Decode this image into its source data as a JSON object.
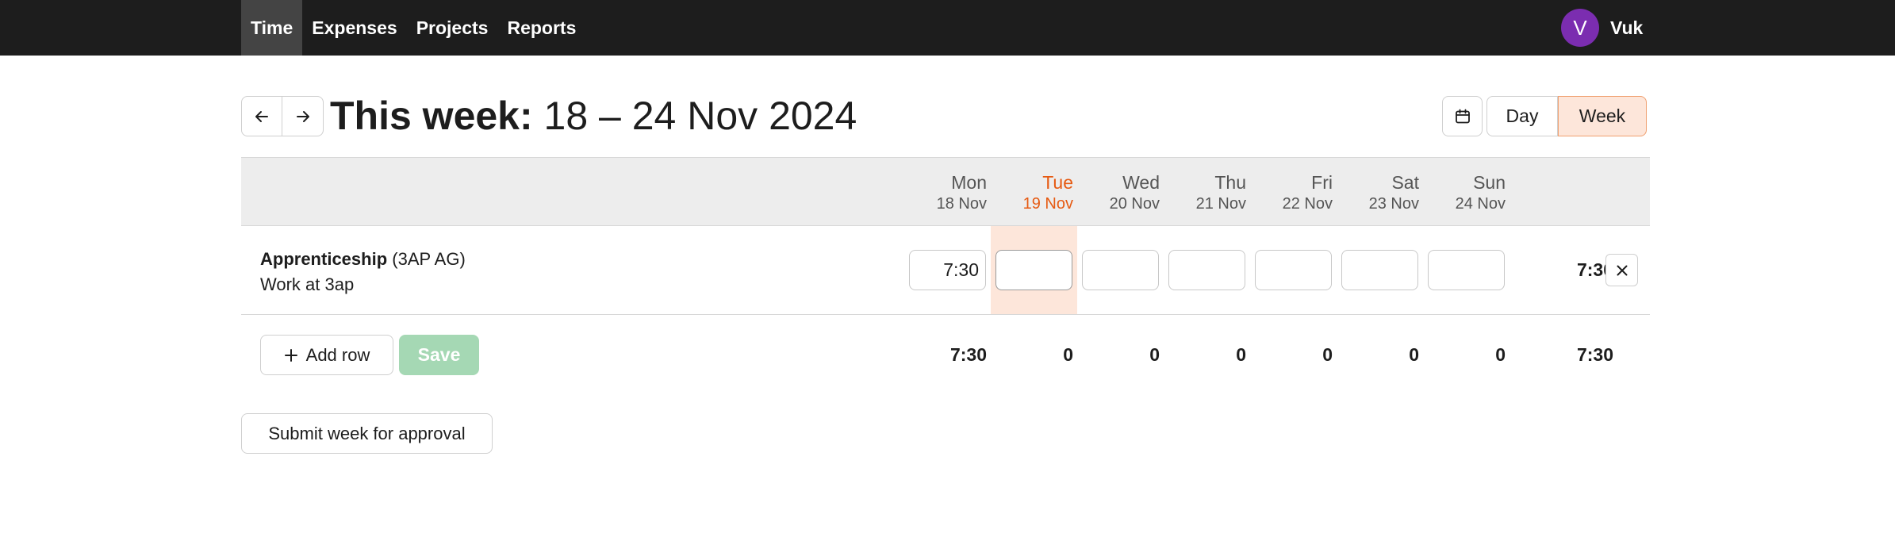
{
  "nav": {
    "items": [
      {
        "label": "Time",
        "active": true
      },
      {
        "label": "Expenses",
        "active": false
      },
      {
        "label": "Projects",
        "active": false
      },
      {
        "label": "Reports",
        "active": false
      }
    ]
  },
  "user": {
    "initial": "V",
    "name": "Vuk",
    "avatar_color": "#7b2db0"
  },
  "header": {
    "title_lead": "This week:",
    "title_range": "18 – 24 Nov 2024",
    "prev_icon": "arrow-left-icon",
    "next_icon": "arrow-right-icon",
    "calendar_icon": "calendar-icon",
    "view_day": "Day",
    "view_week": "Week",
    "active_view": "Week"
  },
  "days": [
    {
      "name": "Mon",
      "date": "18 Nov",
      "today": false
    },
    {
      "name": "Tue",
      "date": "19 Nov",
      "today": true
    },
    {
      "name": "Wed",
      "date": "20 Nov",
      "today": false
    },
    {
      "name": "Thu",
      "date": "21 Nov",
      "today": false
    },
    {
      "name": "Fri",
      "date": "22 Nov",
      "today": false
    },
    {
      "name": "Sat",
      "date": "23 Nov",
      "today": false
    },
    {
      "name": "Sun",
      "date": "24 Nov",
      "today": false
    }
  ],
  "rows": [
    {
      "project": "Apprenticeship",
      "client": "(3AP AG)",
      "task": "Work at 3ap",
      "hours": [
        "7:30",
        "",
        "",
        "",
        "",
        "",
        ""
      ],
      "total": "7:30"
    }
  ],
  "footer": {
    "add_row_label": "Add row",
    "save_label": "Save",
    "day_totals": [
      "7:30",
      "0",
      "0",
      "0",
      "0",
      "0",
      "0"
    ],
    "grand_total": "7:30",
    "submit_label": "Submit week for approval"
  },
  "colors": {
    "nav_bg": "#1d1d1d",
    "accent": "#e65a12",
    "today_bg": "#fde6da",
    "save_disabled": "#a5d8b4"
  }
}
